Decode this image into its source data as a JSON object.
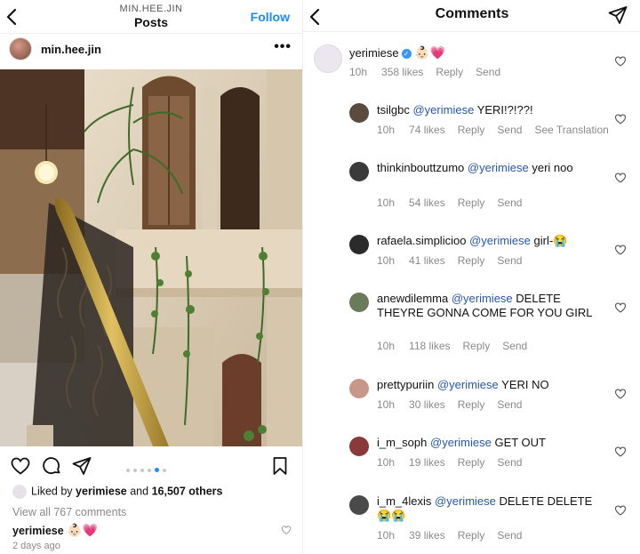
{
  "post_header": {
    "account": "MIN.HEE.JIN",
    "title": "Posts",
    "follow_label": "Follow"
  },
  "post": {
    "username": "min.hee.jin",
    "more_label": "•••",
    "carousel": {
      "dots": 6,
      "active_index": 4
    },
    "liked_by_prefix": "Liked by",
    "liked_by_user": "yerimiese",
    "liked_by_and": "and",
    "liked_by_others": "16,507 others",
    "view_all": "View all 767 comments",
    "caption_user": "yerimiese",
    "caption_text": "👶🏻💗",
    "date": "2 days ago"
  },
  "comments_header": {
    "title": "Comments"
  },
  "top_comment": {
    "username": "yerimiese",
    "text": "👶🏻💗",
    "time": "10h",
    "likes": "358 likes",
    "reply": "Reply",
    "send": "Send"
  },
  "replies": [
    {
      "username": "tsilgbc",
      "mention": "@yerimiese",
      "text": "YERI!?!??!",
      "time": "10h",
      "likes": "74 likes",
      "reply": "Reply",
      "send": "Send",
      "extra": "See Translation",
      "avatar_color": "#5b4a3e"
    },
    {
      "username": "thinkinbouttzumo",
      "mention": "@yerimiese",
      "text": "yeri noo",
      "time": "10h",
      "likes": "54 likes",
      "reply": "Reply",
      "send": "Send",
      "avatar_color": "#3a3a3a"
    },
    {
      "username": "rafaela.simplicioo",
      "mention": "@yerimiese",
      "text": "girl-😭",
      "time": "10h",
      "likes": "41 likes",
      "reply": "Reply",
      "send": "Send",
      "avatar_color": "#2b2b2b"
    },
    {
      "username": "anewdilemma",
      "mention": "@yerimiese",
      "text": "DELETE THEYRE GONNA COME FOR YOU GIRL",
      "time": "10h",
      "likes": "118 likes",
      "reply": "Reply",
      "send": "Send",
      "avatar_color": "#6b7a5a"
    },
    {
      "username": "prettypuriin",
      "mention": "@yerimiese",
      "text": "YERI NO",
      "time": "10h",
      "likes": "30 likes",
      "reply": "Reply",
      "send": "Send",
      "avatar_color": "#c9968a"
    },
    {
      "username": "i_m_soph",
      "mention": "@yerimiese",
      "text": "GET OUT",
      "time": "10h",
      "likes": "19 likes",
      "reply": "Reply",
      "send": "Send",
      "avatar_color": "#8a3a3a"
    },
    {
      "username": "i_m_4lexis",
      "mention": "@yerimiese",
      "text": "DELETE DELETE 😭😭",
      "time": "10h",
      "likes": "39 likes",
      "reply": "Reply",
      "send": "Send",
      "avatar_color": "#4a4a4a"
    }
  ],
  "colors": {
    "link_blue": "#1a8cff",
    "mention_blue": "#2856a8",
    "meta_gray": "#8a8a8a"
  }
}
